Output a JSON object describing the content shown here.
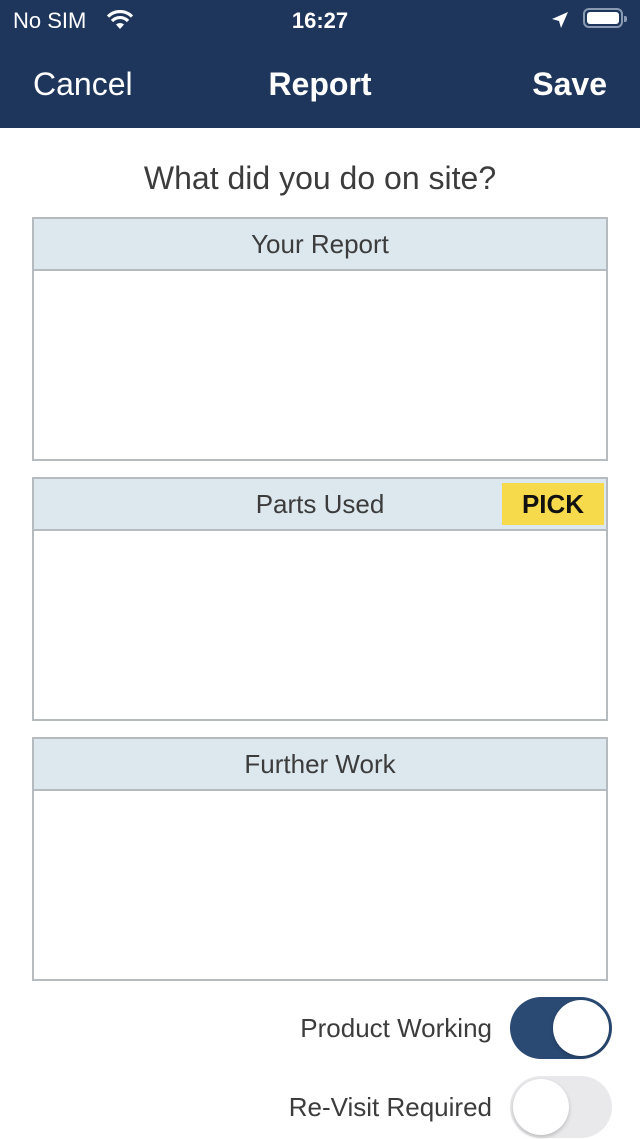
{
  "status_bar": {
    "carrier": "No SIM",
    "time": "16:27"
  },
  "nav": {
    "cancel_label": "Cancel",
    "title": "Report",
    "save_label": "Save"
  },
  "question": "What did you do on site?",
  "sections": [
    {
      "title": "Your Report",
      "value": ""
    },
    {
      "title": "Parts Used",
      "value": "",
      "action_label": "PICK"
    },
    {
      "title": "Further Work",
      "value": ""
    }
  ],
  "toggles": [
    {
      "label": "Product Working",
      "on": true
    },
    {
      "label": "Re-Visit Required",
      "on": false
    }
  ],
  "colors": {
    "nav_bg": "#1f365c",
    "header_bg": "#dde7ee",
    "pick_bg": "#f7d94c",
    "toggle_on": "#2a4a73"
  }
}
